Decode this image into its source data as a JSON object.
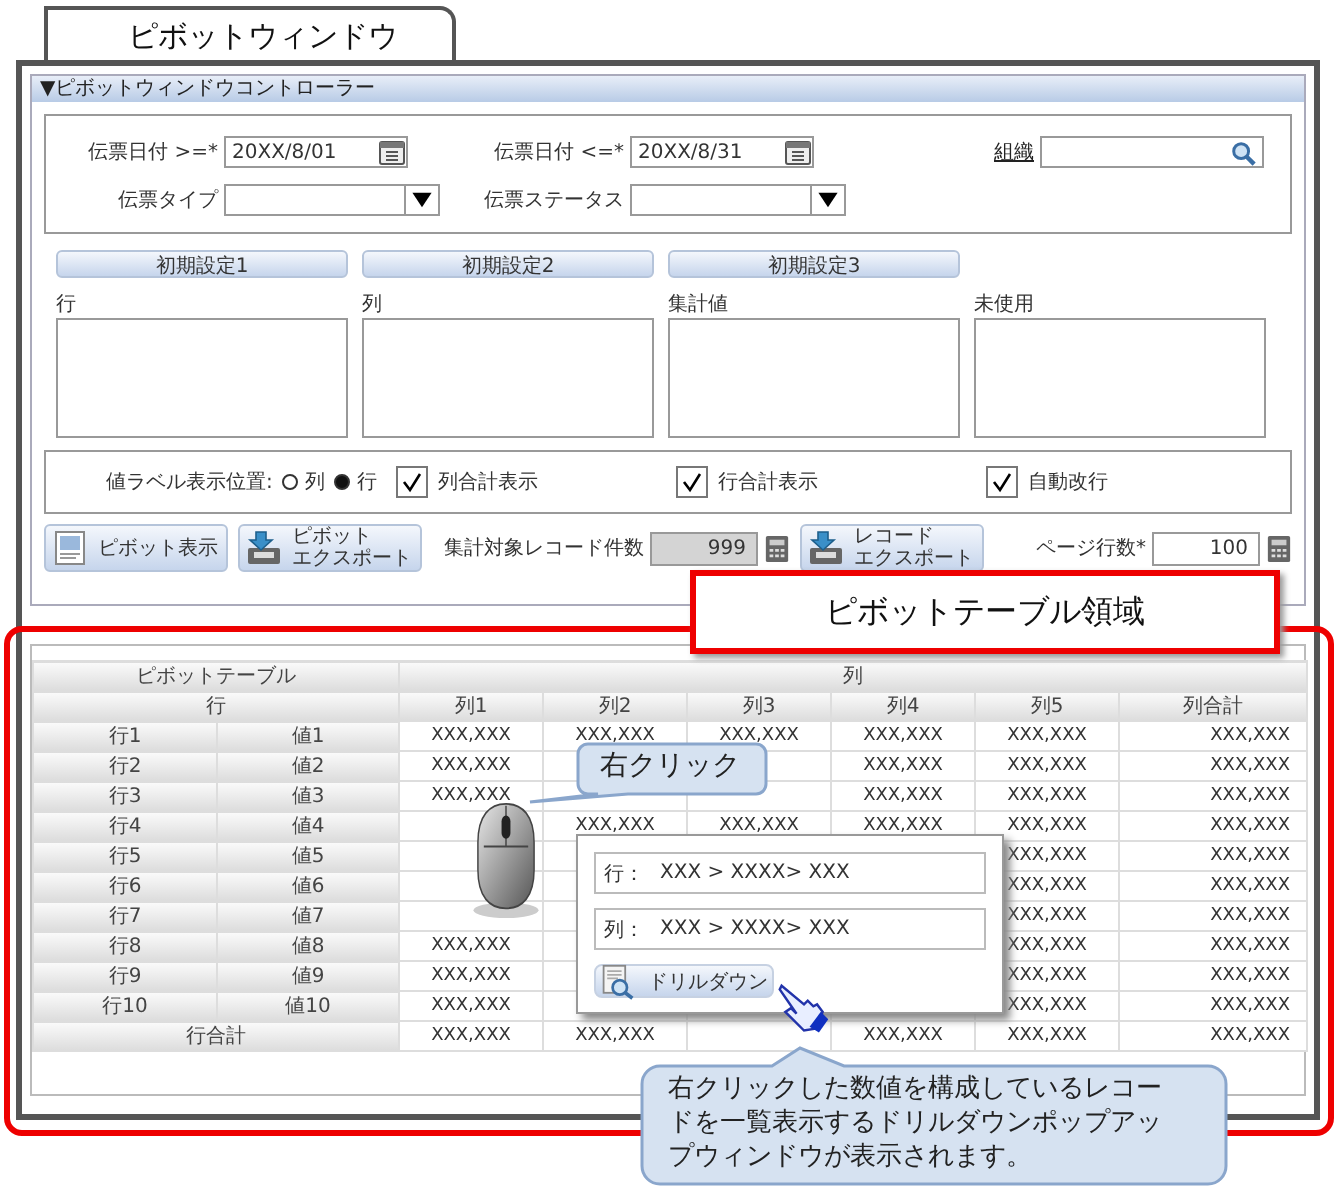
{
  "window": {
    "tab": "ピボットウィンドウ"
  },
  "controller": {
    "title": "▼ピボットウィンドウコントローラー",
    "filters": [
      {
        "kind": "date",
        "label": "伝票日付 >=*",
        "value": "20XX/8/01"
      },
      {
        "kind": "date",
        "label": "伝票日付 <=*",
        "value": "20XX/8/31"
      },
      {
        "kind": "search",
        "label": "組織"
      },
      {
        "kind": "select",
        "label": "伝票タイプ"
      },
      {
        "kind": "select",
        "label": "伝票ステータス"
      }
    ],
    "presets": [
      "初期設定1",
      "初期設定2",
      "初期設定3"
    ],
    "zones": [
      "行",
      "列",
      "集計値",
      "未使用"
    ],
    "value_label": {
      "label": "値ラベル表示位置:",
      "options": [
        {
          "label": "列",
          "selected": false
        },
        {
          "label": "行",
          "selected": true
        }
      ]
    },
    "checkboxes": [
      {
        "label": "列合計表示",
        "checked": true
      },
      {
        "label": "行合計表示",
        "checked": true
      },
      {
        "label": "自動改行",
        "checked": true
      }
    ],
    "toolbar": [
      {
        "kind": "view",
        "lines": [
          "ピボット表示"
        ]
      },
      {
        "kind": "export",
        "lines": [
          "ピボット",
          "エクスポート"
        ]
      },
      {
        "kind": "number",
        "label": "集計対象レコード件数",
        "value": "999",
        "disabled": true
      },
      {
        "kind": "export",
        "lines": [
          "レコード",
          "エクスポート"
        ]
      },
      {
        "kind": "number",
        "label": "ページ行数*",
        "value": "100",
        "disabled": false
      }
    ]
  },
  "region_label": "ピボットテーブル領域",
  "pivot": {
    "title": "ピボットテーブル",
    "row_header": "行",
    "column_header": "列",
    "columns": [
      "列1",
      "列2",
      "列3",
      "列4",
      "列5",
      "列合計"
    ],
    "rows": [
      {
        "label": "行1",
        "value": "値1",
        "cells": [
          "XXX,XXX",
          "XXX,XXX",
          "XXX,XXX",
          "XXX,XXX",
          "XXX,XXX",
          "XXX,XXX"
        ]
      },
      {
        "label": "行2",
        "value": "値2",
        "cells": [
          "XXX,XXX",
          null,
          null,
          "XXX,XXX",
          "XXX,XXX",
          "XXX,XXX"
        ]
      },
      {
        "label": "行3",
        "value": "値3",
        "cells": [
          "XXX,XXX",
          null,
          null,
          "XXX,XXX",
          "XXX,XXX",
          "XXX,XXX"
        ]
      },
      {
        "label": "行4",
        "value": "値4",
        "cells": [
          null,
          "XXX,XXX",
          "XXX,XXX",
          "XXX,XXX",
          "XXX,XXX",
          "XXX,XXX"
        ]
      },
      {
        "label": "行5",
        "value": "値5",
        "cells": [
          null,
          null,
          null,
          null,
          "XXX,XXX",
          "XXX,XXX"
        ]
      },
      {
        "label": "行6",
        "value": "値6",
        "cells": [
          null,
          null,
          null,
          null,
          "XXX,XXX",
          "XXX,XXX"
        ]
      },
      {
        "label": "行7",
        "value": "値7",
        "cells": [
          null,
          null,
          null,
          null,
          "XXX,XXX",
          "XXX,XXX"
        ]
      },
      {
        "label": "行8",
        "value": "値8",
        "cells": [
          "XXX,XXX",
          null,
          null,
          null,
          "XXX,XXX",
          "XXX,XXX"
        ]
      },
      {
        "label": "行9",
        "value": "値9",
        "cells": [
          "XXX,XXX",
          null,
          null,
          null,
          "XXX,XXX",
          "XXX,XXX"
        ]
      },
      {
        "label": "行10",
        "value": "値10",
        "cells": [
          "XXX,XXX",
          null,
          null,
          null,
          "XXX,XXX",
          "XXX,XXX"
        ]
      }
    ],
    "total": {
      "label": "行合計",
      "cells": [
        "XXX,XXX",
        "XXX,XXX",
        null,
        "XXX,XXX",
        "XXX,XXX",
        "XXX,XXX"
      ]
    }
  },
  "right_click_callout": "右クリック",
  "popup": {
    "lines": [
      {
        "label": "行：",
        "path": "XXX > XXXX> XXX"
      },
      {
        "label": "列：",
        "path": "XXX > XXXX> XXX"
      }
    ],
    "button": "ドリルダウン"
  },
  "note_callout": "右クリックした数値を構成しているレコードを一覧表示するドリルダウンポップアップウィンドウが表示されます。"
}
